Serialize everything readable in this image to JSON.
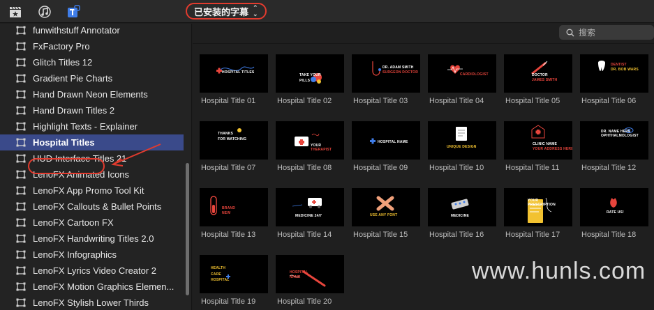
{
  "toolbar": {
    "icons": [
      "clapperboard-star-icon",
      "music-note-icon",
      "titles-t-icon"
    ],
    "dropdown_label": "已安装的字幕"
  },
  "search": {
    "placeholder": "搜索"
  },
  "sidebar": {
    "items": [
      {
        "label": "funwithstuff Annotator"
      },
      {
        "label": "FxFactory Pro"
      },
      {
        "label": "Glitch Titles 12"
      },
      {
        "label": "Gradient Pie Charts"
      },
      {
        "label": "Hand Drawn Neon Elements"
      },
      {
        "label": "Hand Drawn Titles 2"
      },
      {
        "label": "Highlight Texts - Explainer"
      },
      {
        "label": "Hospital Titles"
      },
      {
        "label": "HUD Interface Titles 21"
      },
      {
        "label": "LenoFX Animated Icons"
      },
      {
        "label": "LenoFX App Promo Tool Kit"
      },
      {
        "label": "LenoFX Callouts & Bullet Points"
      },
      {
        "label": "LenoFX Cartoon FX"
      },
      {
        "label": "LenoFX Handwriting Titles 2.0"
      },
      {
        "label": "LenoFX Infographics"
      },
      {
        "label": "LenoFX Lyrics Video Creator 2"
      },
      {
        "label": "LenoFX Motion Graphics Elemen..."
      },
      {
        "label": "LenoFX Stylish Lower Thirds"
      }
    ],
    "selected": "Hospital Titles"
  },
  "tiles": [
    {
      "label": "Hospital Title 01",
      "thumb": [
        "HOSPITAL TITLES"
      ]
    },
    {
      "label": "Hospital Title 02",
      "thumb": [
        "TAKE YOUR",
        "PILLS"
      ]
    },
    {
      "label": "Hospital Title 03",
      "thumb": [
        "DR. ADAM SMITH",
        "SURGEON DOCTOR"
      ]
    },
    {
      "label": "Hospital Title 04",
      "thumb": [
        "CARDIOLOGIST"
      ]
    },
    {
      "label": "Hospital Title 05",
      "thumb": [
        "DOCTOR",
        "JAMES SMITH"
      ]
    },
    {
      "label": "Hospital Title 06",
      "thumb": [
        "DENTIST",
        "DR. BOB WARS"
      ]
    },
    {
      "label": "Hospital Title 07",
      "thumb": [
        "THANKS",
        "FOR WATCHING"
      ]
    },
    {
      "label": "Hospital Title 08",
      "thumb": [
        "YOUR",
        "THERAPIST"
      ]
    },
    {
      "label": "Hospital Title 09",
      "thumb": [
        "HOSPITAL NAME"
      ]
    },
    {
      "label": "Hospital Title 10",
      "thumb": [
        "UNIQUE DESIGN"
      ]
    },
    {
      "label": "Hospital Title 11",
      "thumb": [
        "CLINIC NAME",
        "YOUR ADDRESS HERE"
      ]
    },
    {
      "label": "Hospital Title 12",
      "thumb": [
        "DR. NAME HERE",
        "OPHTHALMOLOGIST"
      ]
    },
    {
      "label": "Hospital Title 13",
      "thumb": [
        "BRAND",
        "NEW"
      ]
    },
    {
      "label": "Hospital Title 14",
      "thumb": [
        "MEDICINE 24/7"
      ]
    },
    {
      "label": "Hospital Title 15",
      "thumb": [
        "USE ANY FONT"
      ]
    },
    {
      "label": "Hospital Title 16",
      "thumb": [
        "MEDICINE"
      ]
    },
    {
      "label": "Hospital Title 17",
      "thumb": [
        "YOUR",
        "PRESCRIPTION"
      ]
    },
    {
      "label": "Hospital Title 18",
      "thumb": [
        "RATE US!"
      ]
    },
    {
      "label": "Hospital Title 19",
      "thumb": [
        "HEALTH",
        "CARE",
        "HOSPITAL"
      ]
    },
    {
      "label": "Hospital Title 20",
      "thumb": [
        "HOSPITAL",
        "NAME"
      ]
    }
  ],
  "watermark": "www.hunls.com",
  "colors": {
    "selection": "#3a4a8a",
    "annotation_red": "#e23b2e",
    "accent_red": "#e8453c",
    "accent_blue": "#3f7de8",
    "accent_yellow": "#f2c230"
  }
}
